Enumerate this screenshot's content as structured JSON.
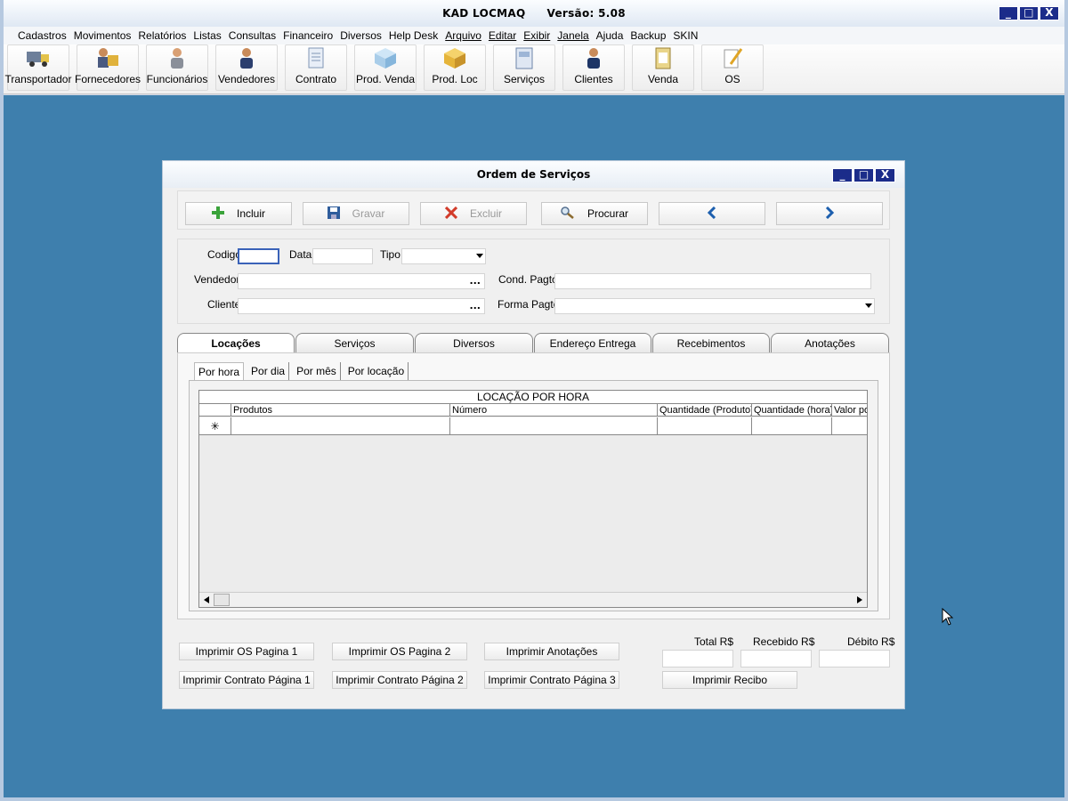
{
  "app": {
    "name": "KAD LOCMAQ",
    "version": "Versão: 5.08",
    "window_buttons": [
      "_",
      "□",
      "X"
    ]
  },
  "menu": [
    "Cadastros",
    "Movimentos",
    "Relatórios",
    "Listas",
    "Consultas",
    "Financeiro",
    "Diversos",
    "Help Desk",
    "Arquivo",
    "Editar",
    "Exibir",
    "Janela",
    "Ajuda",
    "Backup",
    "SKIN"
  ],
  "toolbar": [
    {
      "label": "Transportador",
      "icon": "truck-icon"
    },
    {
      "label": "Fornecedores",
      "icon": "suppliers-icon"
    },
    {
      "label": "Funcionários",
      "icon": "employee-icon"
    },
    {
      "label": "Vendedores",
      "icon": "seller-icon"
    },
    {
      "label": "Contrato",
      "icon": "contract-icon"
    },
    {
      "label": "Prod. Venda",
      "icon": "product-sale-icon"
    },
    {
      "label": "Prod. Loc",
      "icon": "product-rent-icon"
    },
    {
      "label": "Serviços",
      "icon": "services-icon"
    },
    {
      "label": "Clientes",
      "icon": "clients-icon"
    },
    {
      "label": "Venda",
      "icon": "sale-icon"
    },
    {
      "label": "OS",
      "icon": "os-icon"
    }
  ],
  "dialog": {
    "title": "Ordem de Serviços",
    "actions": {
      "incluir": "Incluir",
      "gravar": "Gravar",
      "excluir": "Excluir",
      "procurar": "Procurar"
    },
    "fields": {
      "codigo": "Codigo",
      "data": "Data",
      "tipo": "Tipo",
      "vendedor": "Vendedor",
      "cliente": "Cliente",
      "cond_pagto": "Cond. Pagto",
      "forma_pagto": "Forma Pagto",
      "dots": "..."
    },
    "tabs": [
      "Locações",
      "Serviços",
      "Diversos",
      "Endereço Entrega",
      "Recebimentos",
      "Anotações"
    ],
    "subtabs": [
      "Por hora",
      "Por dia",
      "Por mês",
      "Por locação"
    ],
    "grid": {
      "title": "LOCAÇÃO POR HORA",
      "columns": [
        "Produtos",
        "Número",
        "Quantidade (Produto)",
        "Quantidade (hora)",
        "Valor po"
      ],
      "new_row_marker": "✳"
    },
    "buttons": {
      "os1": "Imprimir OS Pagina 1",
      "os2": "Imprimir OS Pagina 2",
      "anotacoes": "Imprimir Anotações",
      "contrato1": "Imprimir Contrato Página 1",
      "contrato2": "Imprimir Contrato Página 2",
      "contrato3": "Imprimir Contrato Página 3",
      "recibo": "Imprimir Recibo"
    },
    "totals": {
      "total": "Total R$",
      "recebido": "Recebido R$",
      "debito": "Débito R$"
    }
  }
}
